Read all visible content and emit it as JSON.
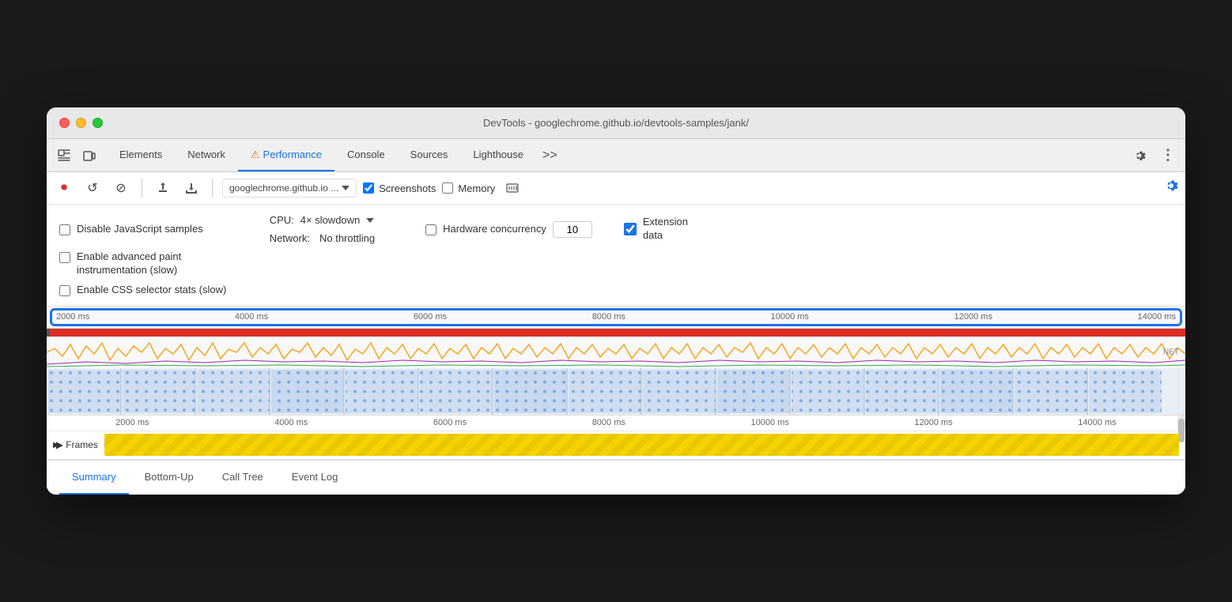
{
  "window": {
    "title": "DevTools - googlechrome.github.io/devtools-samples/jank/"
  },
  "tabs": {
    "items": [
      {
        "label": "Elements",
        "active": false
      },
      {
        "label": "Network",
        "active": false
      },
      {
        "label": "Performance",
        "active": true,
        "warning": true
      },
      {
        "label": "Console",
        "active": false
      },
      {
        "label": "Sources",
        "active": false
      },
      {
        "label": "Lighthouse",
        "active": false
      }
    ],
    "more_label": ">>"
  },
  "toolbar": {
    "record_icon": "⏺",
    "reload_icon": "↺",
    "clear_icon": "⊘",
    "upload_icon": "↑",
    "download_icon": "↓",
    "url_text": "googlechrome.github.io ...",
    "screenshots_label": "Screenshots",
    "memory_label": "Memory",
    "screenshots_checked": true,
    "memory_checked": false,
    "memory_icon": "🖨",
    "settings_icon": "⚙",
    "more_icon": "⋮"
  },
  "settings": {
    "disable_js_label": "Disable JavaScript samples",
    "disable_js_checked": false,
    "advanced_paint_label": "Enable advanced paint\ninstrumentation (slow)",
    "advanced_paint_checked": false,
    "css_selector_label": "Enable CSS selector stats (slow)",
    "css_selector_checked": false,
    "cpu_label": "CPU:",
    "cpu_value": "4× slowdown",
    "network_label": "Network:",
    "network_value": "No throttling",
    "hw_concurrency_label": "Hardware concurrency",
    "hw_concurrency_checked": false,
    "hw_value": "10",
    "extension_label": "Extension\ndata",
    "extension_checked": true
  },
  "timeline": {
    "ruler_marks": [
      "2000 ms",
      "4000 ms",
      "6000 ms",
      "8000 ms",
      "10000 ms",
      "12000 ms",
      "14000 ms"
    ],
    "ruler2_marks": [
      "2000 ms",
      "4000 ms",
      "6000 ms",
      "8000 ms",
      "10000 ms",
      "12000 ms",
      "14000 ms"
    ],
    "net_label": "NET",
    "frames_label": "▶ Frames"
  },
  "bottom_tabs": {
    "items": [
      {
        "label": "Summary",
        "active": true
      },
      {
        "label": "Bottom-Up",
        "active": false
      },
      {
        "label": "Call Tree",
        "active": false
      },
      {
        "label": "Event Log",
        "active": false
      }
    ]
  },
  "colors": {
    "accent_blue": "#1a73e8",
    "fps_red": "#d93025",
    "frames_yellow": "#f5d300",
    "warning_orange": "#e37400"
  }
}
